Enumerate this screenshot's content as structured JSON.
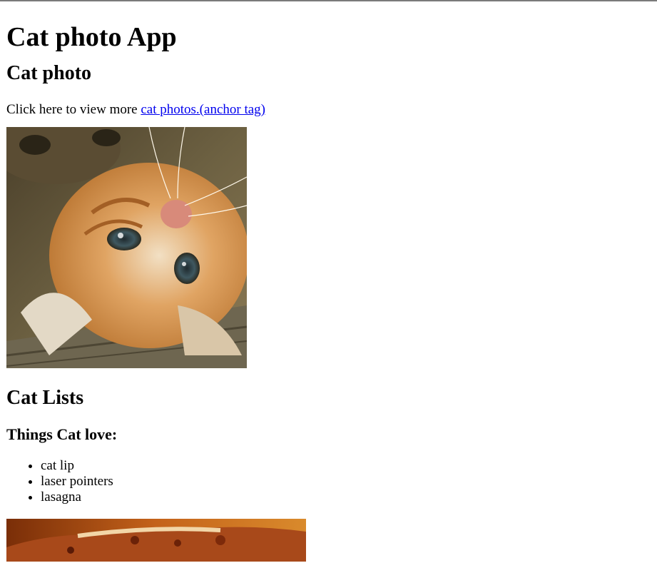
{
  "page": {
    "title": "Cat photo App",
    "photo_section": {
      "heading": "Cat photo",
      "intro_text": "Click here to view more ",
      "link_text": "cat photos.(anchor tag)",
      "image_icon": "kitten-photo"
    },
    "lists_section": {
      "heading": "Cat Lists",
      "subheading": "Things Cat love:",
      "items": [
        "cat lip",
        "laser pointers",
        "lasagna"
      ],
      "image_icon": "lasagna-photo"
    }
  },
  "colors": {
    "link": "#0000ee",
    "top_border": "#7a7a7a"
  }
}
